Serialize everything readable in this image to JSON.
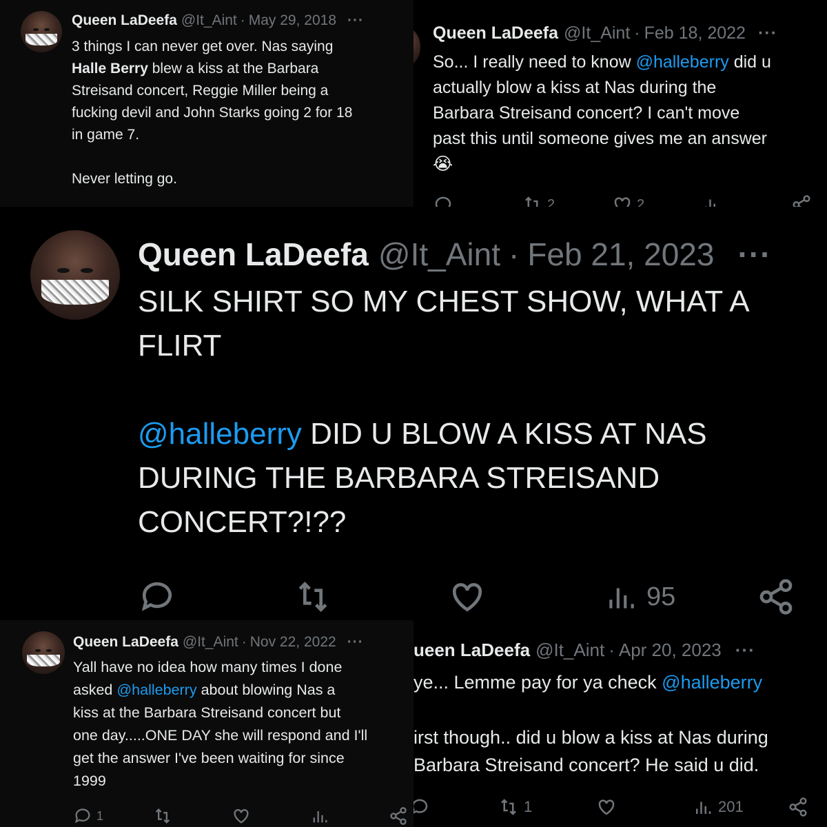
{
  "author": {
    "name": "Queen LaDeefa",
    "handle": "@It_Aint"
  },
  "colors": {
    "mention": "#1d9bf0",
    "muted": "#71767b",
    "text": "#e7e9ea",
    "bg": "#000000"
  },
  "tweets": [
    {
      "date": "May 29, 2018",
      "segments": [
        {
          "t": "3 things I can never get over. Nas saying\n"
        },
        {
          "t": "Halle Berry",
          "style": "bold"
        },
        {
          "t": " blew a kiss at the Barbara\nStreisand concert, Reggie Miller being a\nfucking devil and John Starks going 2 for 18\nin game 7.\n\nNever letting go."
        }
      ]
    },
    {
      "date": "Feb 18, 2022",
      "segments": [
        {
          "t": "So... I really need to know "
        },
        {
          "t": "@halleberry",
          "style": "mention"
        },
        {
          "t": " did u\nactually blow a kiss at Nas during the\nBarbara Streisand concert? I can't move\npast this until someone gives me an answer\n😭"
        }
      ],
      "stats": {
        "retweets": "2",
        "likes": "2"
      }
    },
    {
      "date": "Feb 21, 2023",
      "segments": [
        {
          "t": "SILK SHIRT SO MY CHEST SHOW, WHAT A\nFLIRT\n\n"
        },
        {
          "t": "@halleberry",
          "style": "mention"
        },
        {
          "t": " DID U BLOW A KISS AT NAS\nDURING THE BARBARA STREISAND\nCONCERT?!??"
        }
      ],
      "stats": {
        "views": "95"
      }
    },
    {
      "date": "Nov 22, 2022",
      "segments": [
        {
          "t": "Yall have no idea how many times I done\nasked "
        },
        {
          "t": "@halleberry",
          "style": "mention"
        },
        {
          "t": " about blowing Nas a\nkiss at the Barbara Streisand concert but\none day.....ONE DAY she will respond and I'll\nget the answer I've been waiting for since\n1999"
        }
      ],
      "stats": {
        "replies": "1"
      }
    },
    {
      "date": "Apr 20, 2023",
      "visible_name": "ueen LaDeefa",
      "segments": [
        {
          "t": "ye... Lemme pay for ya check "
        },
        {
          "t": "@halleberry",
          "style": "mention"
        },
        {
          "t": "\n\nirst though.. did u blow a kiss at Nas during\n Barbara Streisand concert? He said u did."
        }
      ],
      "stats": {
        "retweets": "1",
        "views": "201"
      }
    }
  ],
  "icons": [
    "reply-icon",
    "retweet-icon",
    "like-icon",
    "views-icon",
    "share-icon",
    "more-icon"
  ]
}
